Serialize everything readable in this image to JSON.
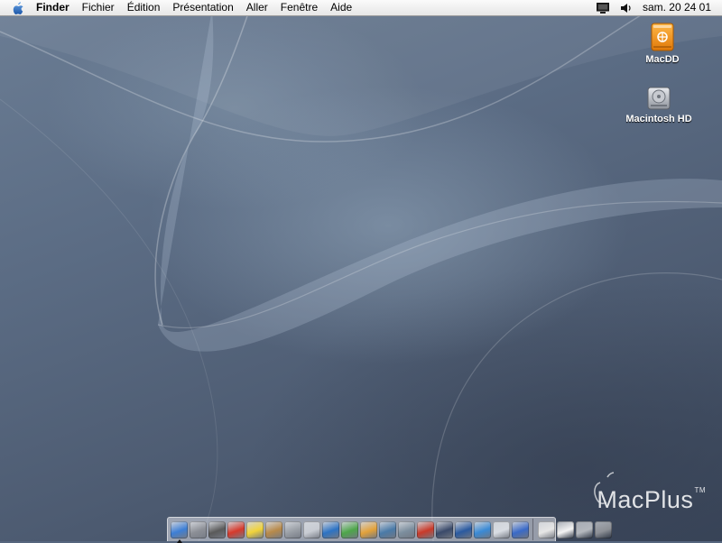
{
  "menubar": {
    "apple_icon": "apple-logo-icon",
    "app_name": "Finder",
    "items": [
      "Fichier",
      "Édition",
      "Présentation",
      "Aller",
      "Fenêtre",
      "Aide"
    ],
    "status_icons": [
      "display-icon",
      "volume-icon"
    ],
    "clock": "sam. 20 24 01"
  },
  "desktop": {
    "icons": [
      {
        "label": "MacDD",
        "icon": "firewire-drive-icon",
        "color": "#f08a10"
      },
      {
        "label": "Macintosh HD",
        "icon": "hard-drive-icon",
        "color": "#b8bcc2"
      }
    ],
    "watermark": {
      "text": "MacPlus",
      "tm": "TM"
    }
  },
  "dock": {
    "apps": [
      {
        "icon": "finder-icon",
        "color": "#3d7fd6",
        "running": true
      },
      {
        "icon": "system-profiler-icon",
        "color": "#8c8f96"
      },
      {
        "icon": "printer-icon",
        "color": "#5a5a5a"
      },
      {
        "icon": "ical-icon",
        "color": "#d63a2c"
      },
      {
        "icon": "stickies-icon",
        "color": "#f1d33a"
      },
      {
        "icon": "address-book-icon",
        "color": "#b88a4a"
      },
      {
        "icon": "calculator-icon",
        "color": "#9a9fa6"
      },
      {
        "icon": "text-edit-icon",
        "color": "#c8ccd3"
      },
      {
        "icon": "internet-explorer-icon",
        "color": "#2d73c4"
      },
      {
        "icon": "itunes-icon",
        "color": "#4ea64a"
      },
      {
        "icon": "iphoto-icon",
        "color": "#e3a23a"
      },
      {
        "icon": "imovie-icon",
        "color": "#4a7aa8"
      },
      {
        "icon": "system-preferences-icon",
        "color": "#7c8e9e"
      },
      {
        "icon": "acrobat-icon",
        "color": "#c93a2a"
      },
      {
        "icon": "network-utility-icon",
        "color": "#3a4a6a"
      },
      {
        "icon": "script-editor-icon",
        "color": "#2a5aa0"
      },
      {
        "icon": "safari-icon",
        "color": "#3a8ad6"
      },
      {
        "icon": "mail-icon",
        "color": "#d8dce2"
      },
      {
        "icon": "ichat-icon",
        "color": "#3a6ac8"
      }
    ],
    "tray": [
      {
        "icon": "home-folder-icon",
        "color": "#e6e6e6"
      },
      {
        "icon": "document-icon",
        "color": "#f4f4f4"
      },
      {
        "icon": "dashboard-icon",
        "color": "#b4b8be"
      },
      {
        "icon": "trash-icon",
        "color": "#8d9096"
      }
    ]
  }
}
